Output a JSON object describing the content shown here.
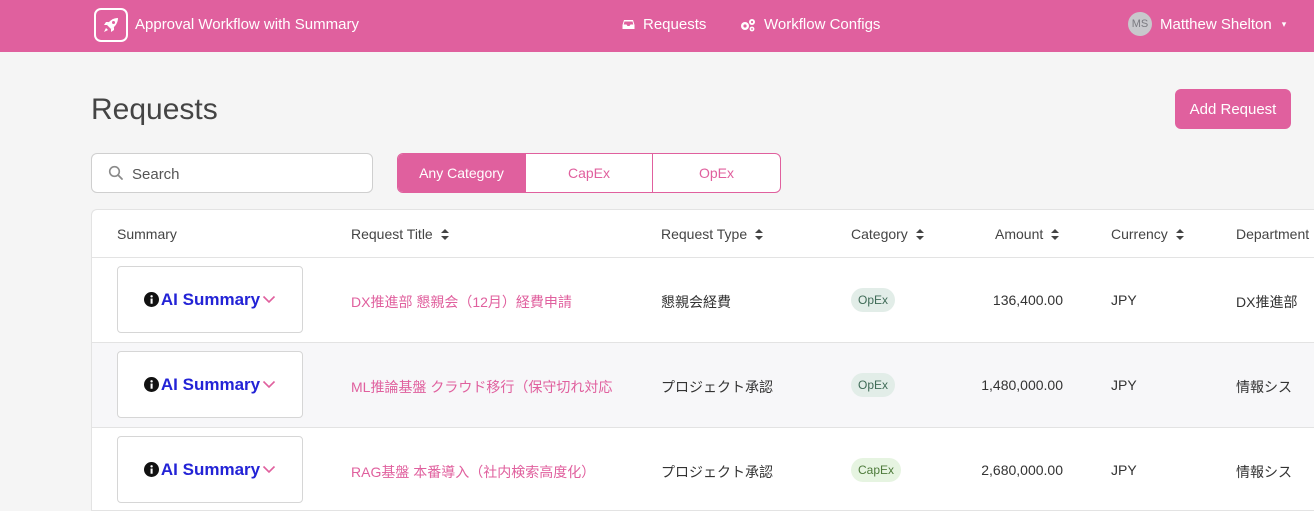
{
  "header": {
    "app_title": "Approval Workflow with Summary",
    "nav": [
      {
        "label": "Requests",
        "icon": "inbox-icon"
      },
      {
        "label": "Workflow Configs",
        "icon": "cogs-icon"
      }
    ],
    "user": {
      "initials": "MS",
      "name": "Matthew Shelton"
    }
  },
  "page": {
    "title": "Requests",
    "add_button_label": "Add Request"
  },
  "search": {
    "placeholder": "Search",
    "value": ""
  },
  "category_filter": {
    "options": [
      "Any Category",
      "CapEx",
      "OpEx"
    ],
    "selected": "Any Category"
  },
  "table": {
    "columns": [
      "Summary",
      "Request Title",
      "Request Type",
      "Category",
      "Amount",
      "Currency",
      "Department"
    ],
    "rows": [
      {
        "summary": "AI Summary",
        "title": "DX推進部 懇親会（12月）経費申請",
        "type": "懇親会経費",
        "category": "OpEx",
        "amount": "136,400.00",
        "currency": "JPY",
        "department": "DX推進部"
      },
      {
        "summary": "AI Summary",
        "title": "ML推論基盤 クラウド移行（保守切れ対応",
        "type": "プロジェクト承認",
        "category": "OpEx",
        "amount": "1,480,000.00",
        "currency": "JPY",
        "department": "情報シス"
      },
      {
        "summary": "AI Summary",
        "title": "RAG基盤 本番導入（社内検索高度化）",
        "type": "プロジェクト承認",
        "category": "CapEx",
        "amount": "2,680,000.00",
        "currency": "JPY",
        "department": "情報シス"
      }
    ]
  },
  "colors": {
    "brand": "#e0609e",
    "summary_text": "#2323d6"
  }
}
